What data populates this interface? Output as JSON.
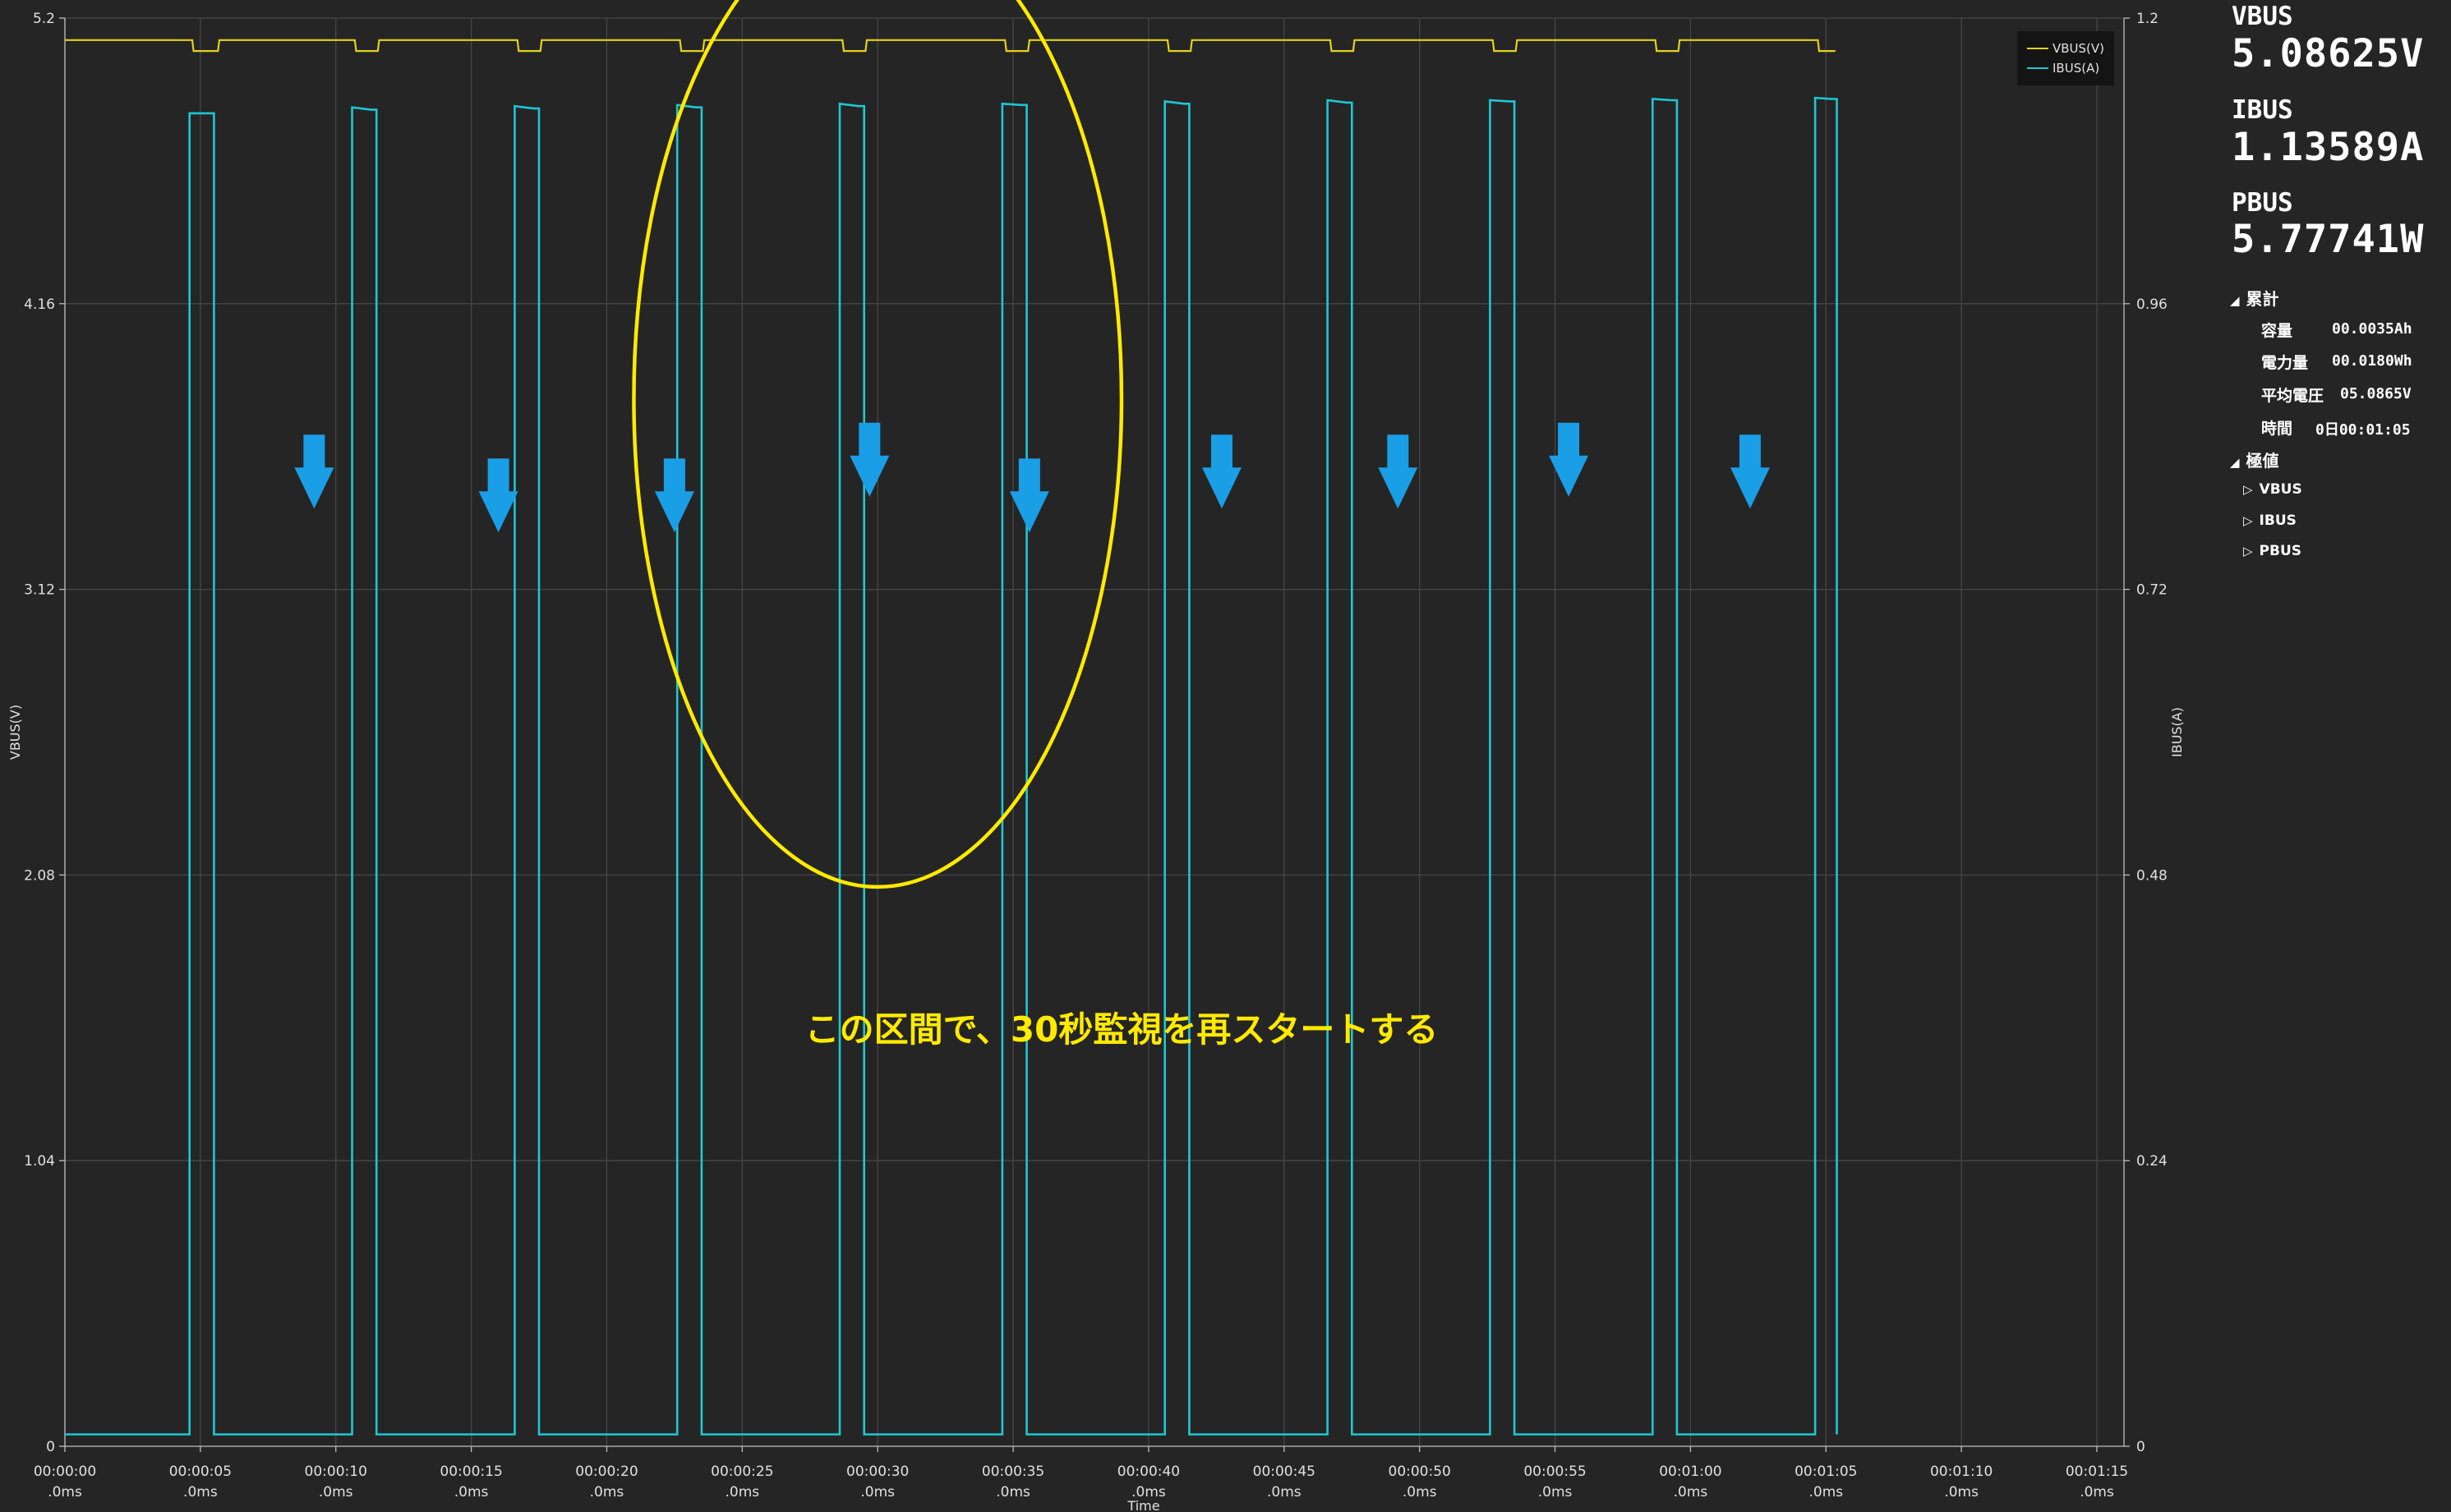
{
  "colors": {
    "vbus": "#e3d21c",
    "ibus": "#1fc6d4",
    "grid": "#474747",
    "arrow": "#1a9ee6",
    "annotation": "#ffea00"
  },
  "chart_data": {
    "type": "line",
    "xlabel": "Time",
    "ylabel_left": "VBUS(V)",
    "ylabel_right": "IBUS(A)",
    "xlim": [
      0,
      76
    ],
    "ylim_left": [
      0,
      5.2
    ],
    "ylim_right": [
      0,
      1.2
    ],
    "left_ticks": [
      "0",
      "1.04",
      "2.08",
      "3.12",
      "4.16",
      "5.2"
    ],
    "right_ticks": [
      "0",
      "0.24",
      "0.48",
      "0.72",
      "0.96",
      "1.2"
    ],
    "x_ticks": [
      {
        "top": "00:00:00",
        "bottom": ".0ms",
        "t": 0
      },
      {
        "top": "00:00:05",
        "bottom": ".0ms",
        "t": 5
      },
      {
        "top": "00:00:10",
        "bottom": ".0ms",
        "t": 10
      },
      {
        "top": "00:00:15",
        "bottom": ".0ms",
        "t": 15
      },
      {
        "top": "00:00:20",
        "bottom": ".0ms",
        "t": 20
      },
      {
        "top": "00:00:25",
        "bottom": ".0ms",
        "t": 25
      },
      {
        "top": "00:00:30",
        "bottom": ".0ms",
        "t": 30
      },
      {
        "top": "00:00:35",
        "bottom": ".0ms",
        "t": 35
      },
      {
        "top": "00:00:40",
        "bottom": ".0ms",
        "t": 40
      },
      {
        "top": "00:00:45",
        "bottom": ".0ms",
        "t": 45
      },
      {
        "top": "00:00:50",
        "bottom": ".0ms",
        "t": 50
      },
      {
        "top": "00:00:55",
        "bottom": ".0ms",
        "t": 55
      },
      {
        "top": "00:01:00",
        "bottom": ".0ms",
        "t": 60
      },
      {
        "top": "00:01:05",
        "bottom": ".0ms",
        "t": 65
      },
      {
        "top": "00:01:10",
        "bottom": ".0ms",
        "t": 70
      },
      {
        "top": "00:01:15",
        "bottom": ".0ms",
        "t": 75
      }
    ],
    "grid": true,
    "legend_position": "top-right",
    "series": [
      {
        "name": "VBUS(V)",
        "axis": "left",
        "baseline": 5.12,
        "dip": 5.08,
        "dips": [
          [
            4.7,
            5.7
          ],
          [
            10.7,
            11.6
          ],
          [
            16.7,
            17.6
          ],
          [
            22.7,
            23.6
          ],
          [
            28.7,
            29.6
          ],
          [
            34.7,
            35.6
          ],
          [
            40.7,
            41.6
          ],
          [
            46.7,
            47.6
          ],
          [
            52.7,
            53.6
          ],
          [
            58.7,
            59.6
          ],
          [
            64.7,
            65.4
          ]
        ],
        "end_t": 65.4
      },
      {
        "name": "IBUS(A)",
        "axis": "right",
        "low": 0.01,
        "end_t": 65.4,
        "pulses": [
          {
            "start": 4.6,
            "end": 5.5,
            "peak_start": 1.12,
            "peak_end": 1.12
          },
          {
            "start": 10.6,
            "end": 11.5,
            "peak_start": 1.125,
            "peak_end": 1.123
          },
          {
            "start": 16.6,
            "end": 17.5,
            "peak_start": 1.126,
            "peak_end": 1.124
          },
          {
            "start": 22.6,
            "end": 23.5,
            "peak_start": 1.127,
            "peak_end": 1.125
          },
          {
            "start": 28.6,
            "end": 29.5,
            "peak_start": 1.128,
            "peak_end": 1.126
          },
          {
            "start": 34.6,
            "end": 35.5,
            "peak_start": 1.128,
            "peak_end": 1.127
          },
          {
            "start": 40.6,
            "end": 41.5,
            "peak_start": 1.13,
            "peak_end": 1.128
          },
          {
            "start": 46.6,
            "end": 47.5,
            "peak_start": 1.131,
            "peak_end": 1.129
          },
          {
            "start": 52.6,
            "end": 53.5,
            "peak_start": 1.131,
            "peak_end": 1.13
          },
          {
            "start": 58.6,
            "end": 59.5,
            "peak_start": 1.132,
            "peak_end": 1.131
          },
          {
            "start": 64.6,
            "end": 65.4,
            "peak_start": 1.133,
            "peak_end": 1.132
          }
        ]
      }
    ],
    "annotations": {
      "text": "この区間で、30秒監視を再スタートする",
      "arrows": [
        {
          "t": 9.2,
          "v": 0.85
        },
        {
          "t": 16.0,
          "v": 0.83
        },
        {
          "t": 22.5,
          "v": 0.83
        },
        {
          "t": 29.7,
          "v": 0.86
        },
        {
          "t": 35.6,
          "v": 0.83
        },
        {
          "t": 42.7,
          "v": 0.85
        },
        {
          "t": 49.2,
          "v": 0.85
        },
        {
          "t": 55.5,
          "v": 0.86
        },
        {
          "t": 62.2,
          "v": 0.85
        }
      ],
      "ellipse": {
        "t_center": 30.0,
        "v_center": 0.88,
        "t_radius": 9.0,
        "v_radius": 0.41
      }
    }
  },
  "side_panel": {
    "vbus_label": "VBUS",
    "vbus_value": "5.08625V",
    "ibus_label": "IBUS",
    "ibus_value": "1.13589A",
    "pbus_label": "PBUS",
    "pbus_value": "5.77741W",
    "cumulative_title": "累計",
    "cumulative": [
      {
        "label": "容量",
        "value": "00.0035Ah"
      },
      {
        "label": "電力量",
        "value": "00.0180Wh"
      },
      {
        "label": "平均電圧",
        "value": "05.0865V"
      },
      {
        "label": "時間",
        "value": "0日00:01:05"
      }
    ],
    "extreme_title": "極値",
    "extremes": [
      "VBUS",
      "IBUS",
      "PBUS"
    ]
  }
}
